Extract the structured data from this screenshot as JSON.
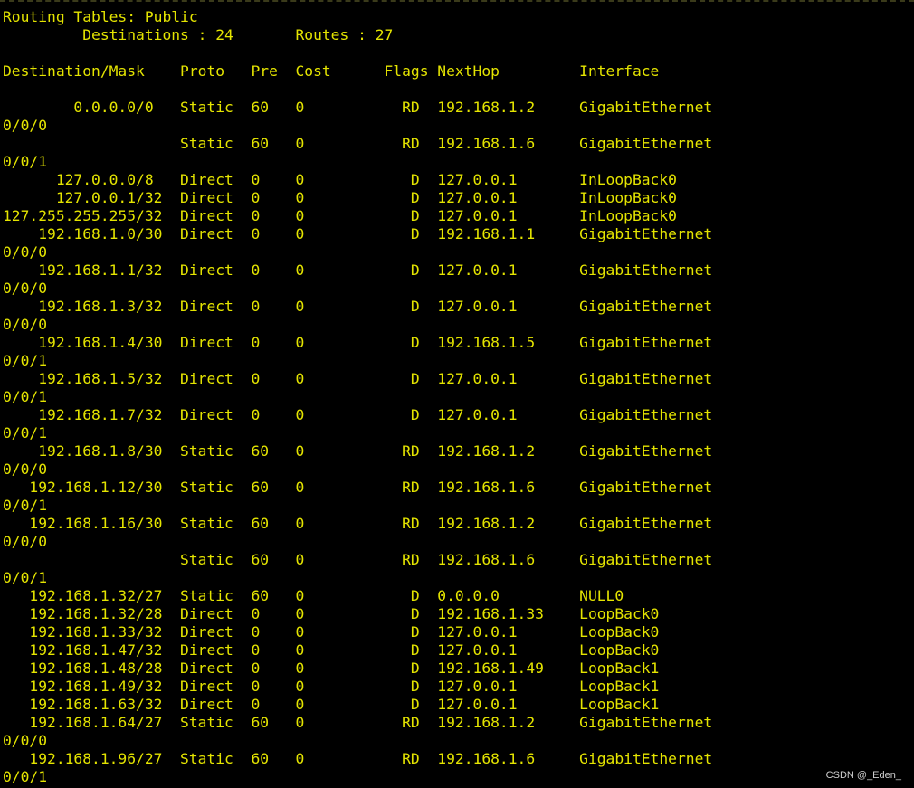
{
  "terminal": {
    "text_color": "#e4e400",
    "background_color": "#000000",
    "lines": [
      "Routing Tables: Public",
      "         Destinations : 24       Routes : 27",
      "",
      "Destination/Mask    Proto   Pre  Cost      Flags NextHop         Interface",
      "",
      "        0.0.0.0/0   Static  60   0           RD  192.168.1.2     GigabitEthernet",
      "0/0/0",
      "                    Static  60   0           RD  192.168.1.6     GigabitEthernet",
      "0/0/1",
      "      127.0.0.0/8   Direct  0    0            D  127.0.0.1       InLoopBack0",
      "      127.0.0.1/32  Direct  0    0            D  127.0.0.1       InLoopBack0",
      "127.255.255.255/32  Direct  0    0            D  127.0.0.1       InLoopBack0",
      "    192.168.1.0/30  Direct  0    0            D  192.168.1.1     GigabitEthernet",
      "0/0/0",
      "    192.168.1.1/32  Direct  0    0            D  127.0.0.1       GigabitEthernet",
      "0/0/0",
      "    192.168.1.3/32  Direct  0    0            D  127.0.0.1       GigabitEthernet",
      "0/0/0",
      "    192.168.1.4/30  Direct  0    0            D  192.168.1.5     GigabitEthernet",
      "0/0/1",
      "    192.168.1.5/32  Direct  0    0            D  127.0.0.1       GigabitEthernet",
      "0/0/1",
      "    192.168.1.7/32  Direct  0    0            D  127.0.0.1       GigabitEthernet",
      "0/0/1",
      "    192.168.1.8/30  Static  60   0           RD  192.168.1.2     GigabitEthernet",
      "0/0/0",
      "   192.168.1.12/30  Static  60   0           RD  192.168.1.6     GigabitEthernet",
      "0/0/1",
      "   192.168.1.16/30  Static  60   0           RD  192.168.1.2     GigabitEthernet",
      "0/0/0",
      "                    Static  60   0           RD  192.168.1.6     GigabitEthernet",
      "0/0/1",
      "   192.168.1.32/27  Static  60   0            D  0.0.0.0         NULL0",
      "   192.168.1.32/28  Direct  0    0            D  192.168.1.33    LoopBack0",
      "   192.168.1.33/32  Direct  0    0            D  127.0.0.1       LoopBack0",
      "   192.168.1.47/32  Direct  0    0            D  127.0.0.1       LoopBack0",
      "   192.168.1.48/28  Direct  0    0            D  192.168.1.49    LoopBack1",
      "   192.168.1.49/32  Direct  0    0            D  127.0.0.1       LoopBack1",
      "   192.168.1.63/32  Direct  0    0            D  127.0.0.1       LoopBack1",
      "   192.168.1.64/27  Static  60   0           RD  192.168.1.2     GigabitEthernet",
      "0/0/0",
      "   192.168.1.96/27  Static  60   0           RD  192.168.1.6     GigabitEthernet",
      "0/0/1"
    ]
  },
  "watermark": {
    "text": "CSDN @_Eden_"
  }
}
